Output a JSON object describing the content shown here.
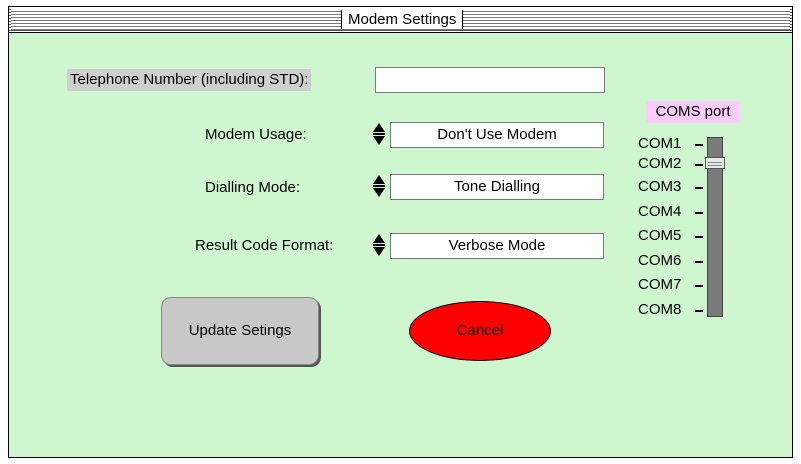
{
  "window": {
    "title": "Modem Settings"
  },
  "telephone": {
    "label": "Telephone Number (including STD):",
    "value": ""
  },
  "modem_usage": {
    "label": "Modem Usage:",
    "value": "Don't Use Modem"
  },
  "dialling_mode": {
    "label": "Dialling Mode:",
    "value": "Tone Dialling"
  },
  "result_code": {
    "label": "Result Code Format:",
    "value": "Verbose Mode"
  },
  "buttons": {
    "update": "Update Setings",
    "cancel": "Cancel"
  },
  "coms": {
    "label": "COMS port",
    "ports": [
      "COM1",
      "COM2",
      "COM3",
      "COM4",
      "COM5",
      "COM6",
      "COM7",
      "COM8"
    ],
    "selected": "COM2"
  },
  "colors": {
    "background": "#cef7cf",
    "cancel": "#ff0000",
    "coms_label_bg": "#ffccff",
    "button_gray": "#c8c8c8"
  }
}
